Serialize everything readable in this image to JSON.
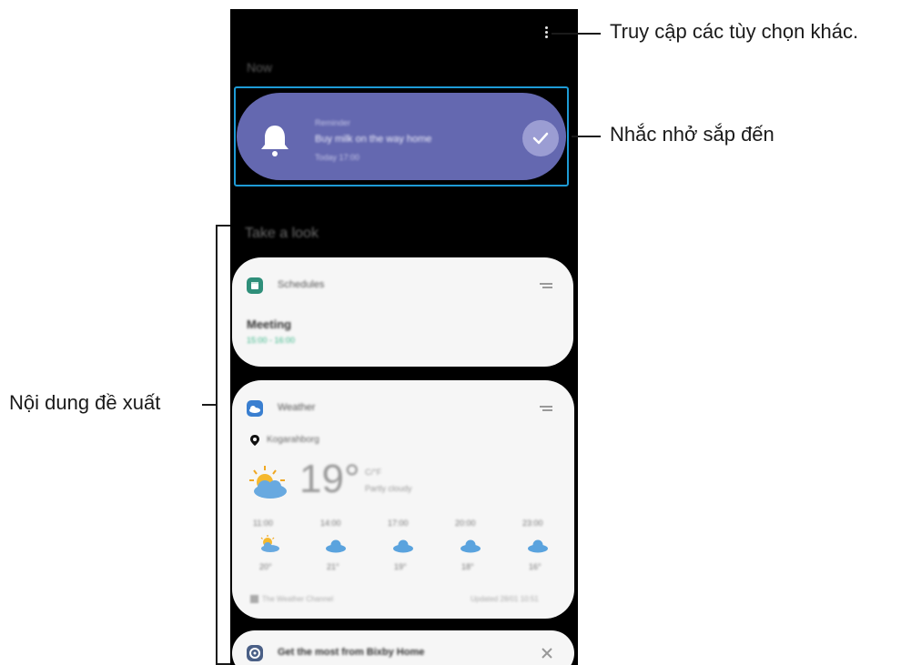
{
  "header": {
    "section_now": "Now",
    "more_options_icon": "more-vertical-icon"
  },
  "reminder": {
    "label": "Reminder",
    "title": "Buy milk on the way home",
    "time": "Today 17:00",
    "icon": "bell-icon",
    "action_icon": "check-icon",
    "color": "#6468b0"
  },
  "section_look": "Take a look",
  "schedules": {
    "title": "Schedules",
    "event": "Meeting",
    "time": "15:00 - 16:00",
    "time_color": "#3bb88a"
  },
  "weather": {
    "title": "Weather",
    "location": "Kogarahborg",
    "temp": "19°",
    "unit": "C/°F",
    "condition": "Partly cloudy",
    "hours": [
      "11:00",
      "14:00",
      "17:00",
      "20:00",
      "23:00"
    ],
    "temps": [
      "20°",
      "21°",
      "19°",
      "18°",
      "16°"
    ],
    "provider": "The Weather Channel",
    "updated": "Updated 28/01 10:51"
  },
  "tip": {
    "title": "Get the most from Bixby Home",
    "close_icon": "close-icon"
  },
  "callouts": {
    "more_options": "Truy cập các tùy chọn khác.",
    "reminder": "Nhắc nhở sắp đến",
    "suggested": "Nội dung đề xuất"
  }
}
